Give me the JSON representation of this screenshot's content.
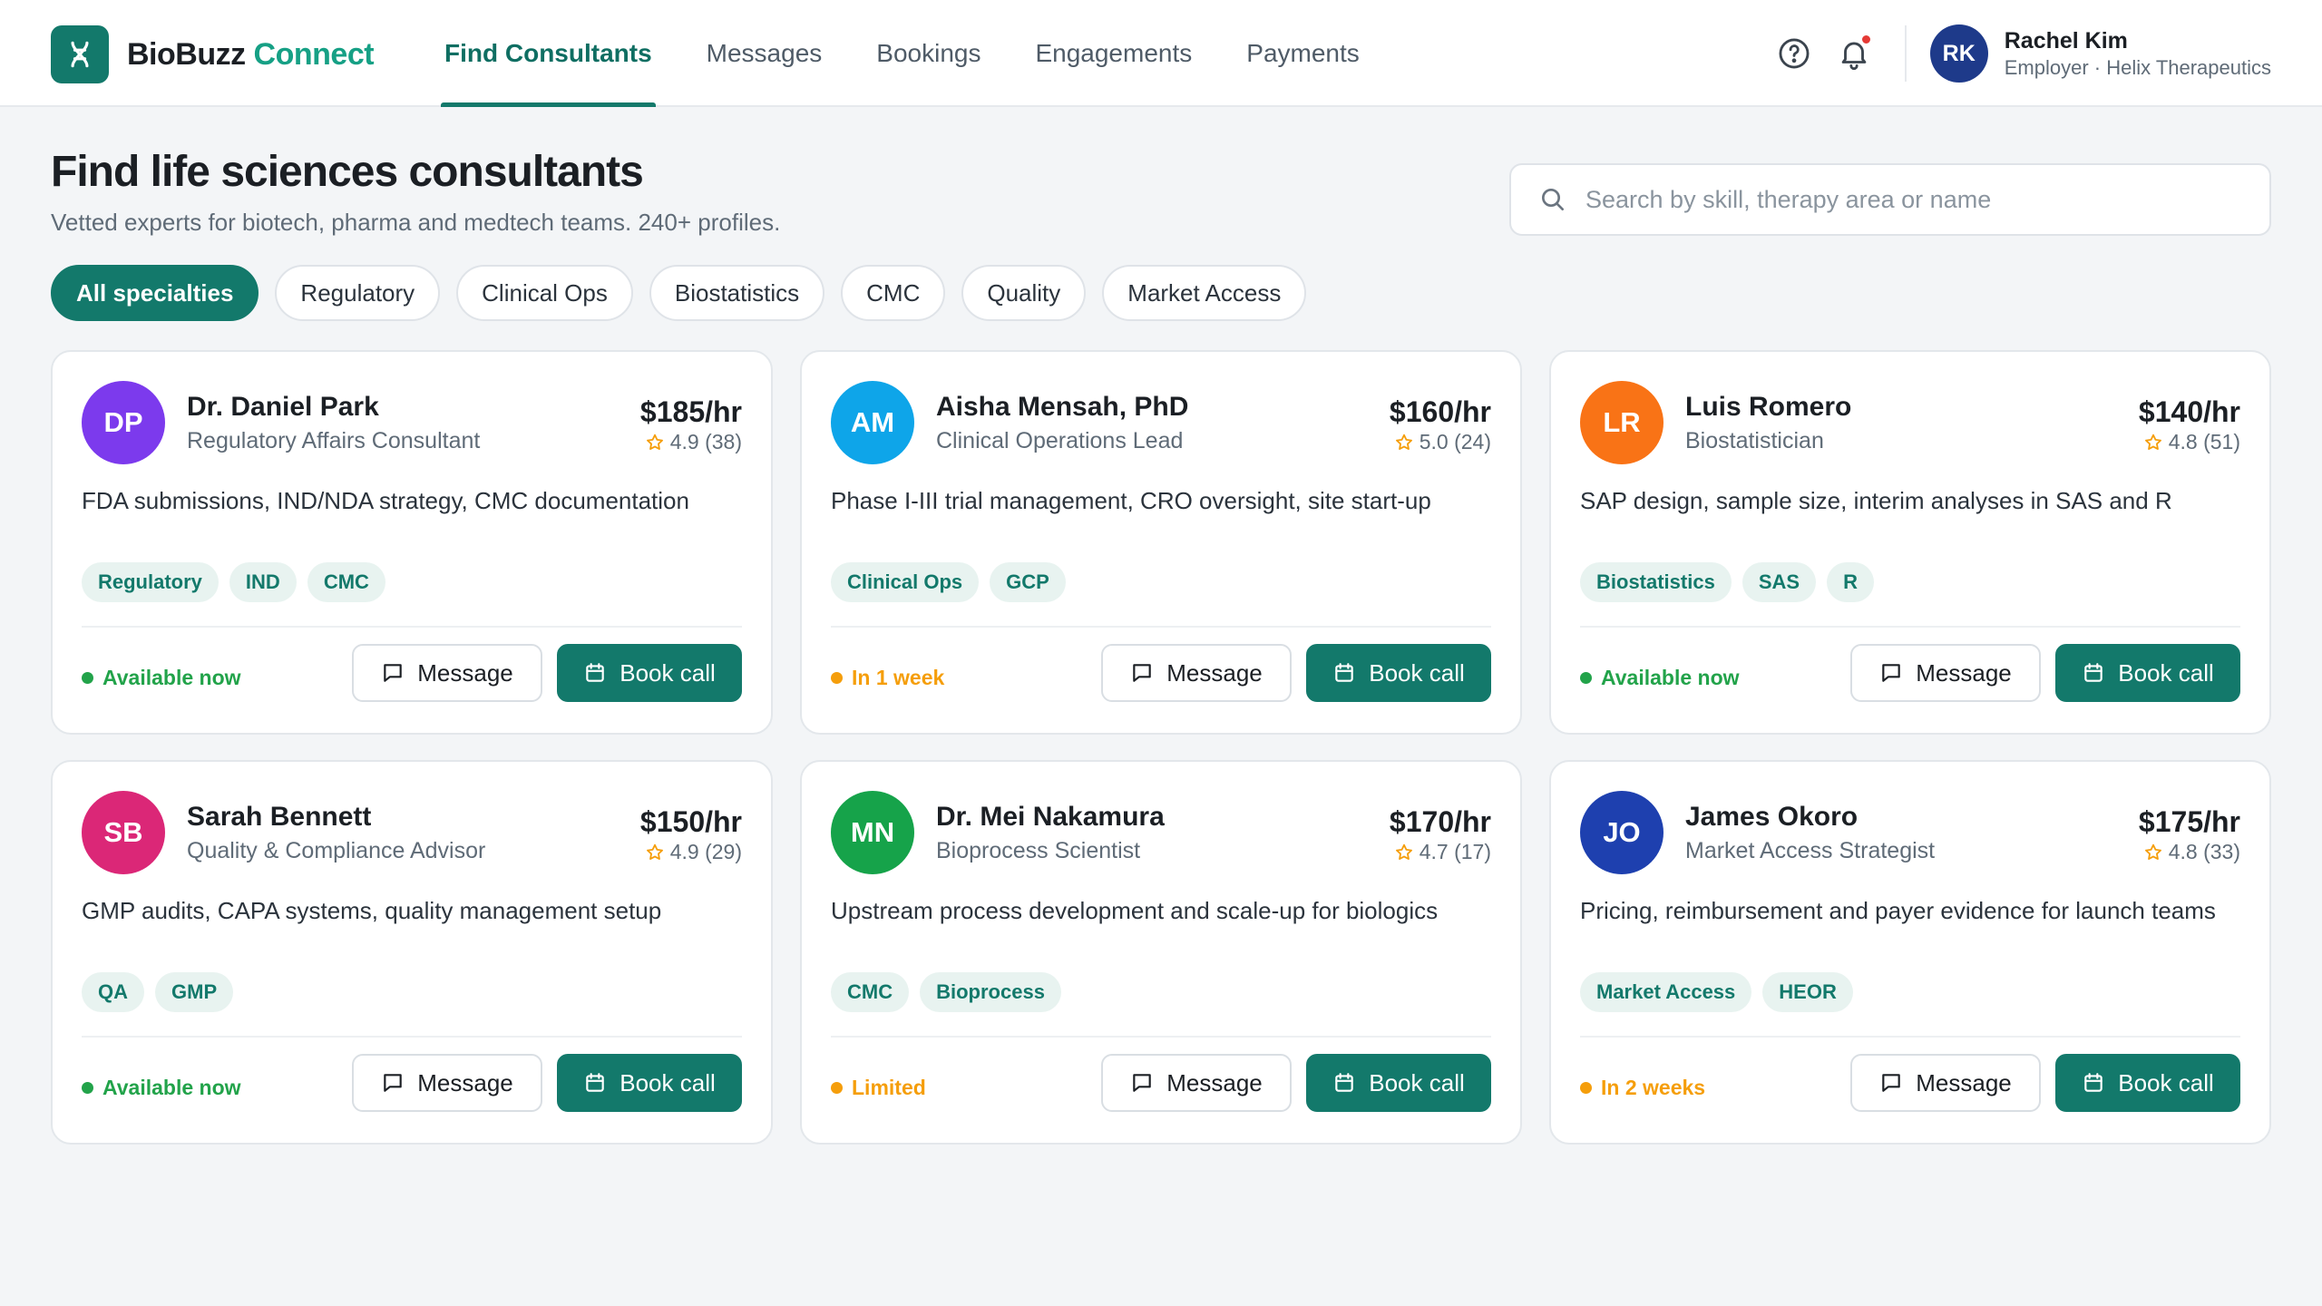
{
  "brand": {
    "name_main": "BioBuzz",
    "name_accent": "Connect"
  },
  "nav": {
    "items": [
      {
        "label": "Find Consultants",
        "active": true
      },
      {
        "label": "Messages",
        "active": false
      },
      {
        "label": "Bookings",
        "active": false
      },
      {
        "label": "Engagements",
        "active": false
      },
      {
        "label": "Payments",
        "active": false
      }
    ]
  },
  "user": {
    "initials": "RK",
    "name": "Rachel Kim",
    "role": "Employer · Helix Therapeutics"
  },
  "header": {
    "title": "Find life sciences consultants",
    "subtitle": "Vetted experts for biotech, pharma and medtech teams. 240+ profiles."
  },
  "search": {
    "placeholder": "Search by skill, therapy area or name",
    "value": ""
  },
  "filters": [
    "All specialties",
    "Regulatory",
    "Clinical Ops",
    "Biostatistics",
    "CMC",
    "Quality",
    "Market Access"
  ],
  "buttons": {
    "message": "Message",
    "book": "Book call"
  },
  "colors": {
    "brand": "#13796b",
    "available": "#22a34a",
    "pending": "#f59e0b",
    "notification": "#e53935"
  },
  "consultants": [
    {
      "initials": "DP",
      "name": "Dr. Daniel Park",
      "title": "Regulatory Affairs Consultant",
      "rate": "$185/hr",
      "rating": "4.9 (38)",
      "description": "FDA submissions, IND/NDA strategy, CMC documentation",
      "tags": [
        "Regulatory",
        "IND",
        "CMC"
      ],
      "availability": "Available now",
      "status": "available",
      "avatar_color": "#7c3aed"
    },
    {
      "initials": "AM",
      "name": "Aisha Mensah, PhD",
      "title": "Clinical Operations Lead",
      "rate": "$160/hr",
      "rating": "5.0 (24)",
      "description": "Phase I-III trial management, CRO oversight, site start-up",
      "tags": [
        "Clinical Ops",
        "GCP"
      ],
      "availability": "In 1 week",
      "status": "pending",
      "avatar_color": "#0ea5e9"
    },
    {
      "initials": "LR",
      "name": "Luis Romero",
      "title": "Biostatistician",
      "rate": "$140/hr",
      "rating": "4.8 (51)",
      "description": "SAP design, sample size, interim analyses in SAS and R",
      "tags": [
        "Biostatistics",
        "SAS",
        "R"
      ],
      "availability": "Available now",
      "status": "available",
      "avatar_color": "#f97316"
    },
    {
      "initials": "SB",
      "name": "Sarah Bennett",
      "title": "Quality & Compliance Advisor",
      "rate": "$150/hr",
      "rating": "4.9 (29)",
      "description": "GMP audits, CAPA systems, quality management setup",
      "tags": [
        "QA",
        "GMP"
      ],
      "availability": "Available now",
      "status": "available",
      "avatar_color": "#db2777"
    },
    {
      "initials": "MN",
      "name": "Dr. Mei Nakamura",
      "title": "Bioprocess Scientist",
      "rate": "$170/hr",
      "rating": "4.7 (17)",
      "description": "Upstream process development and scale-up for biologics",
      "tags": [
        "CMC",
        "Bioprocess"
      ],
      "availability": "Limited",
      "status": "pending",
      "avatar_color": "#16a34a"
    },
    {
      "initials": "JO",
      "name": "James Okoro",
      "title": "Market Access Strategist",
      "rate": "$175/hr",
      "rating": "4.8 (33)",
      "description": "Pricing, reimbursement and payer evidence for launch teams",
      "tags": [
        "Market Access",
        "HEOR"
      ],
      "availability": "In 2 weeks",
      "status": "pending",
      "avatar_color": "#1e40af"
    }
  ]
}
